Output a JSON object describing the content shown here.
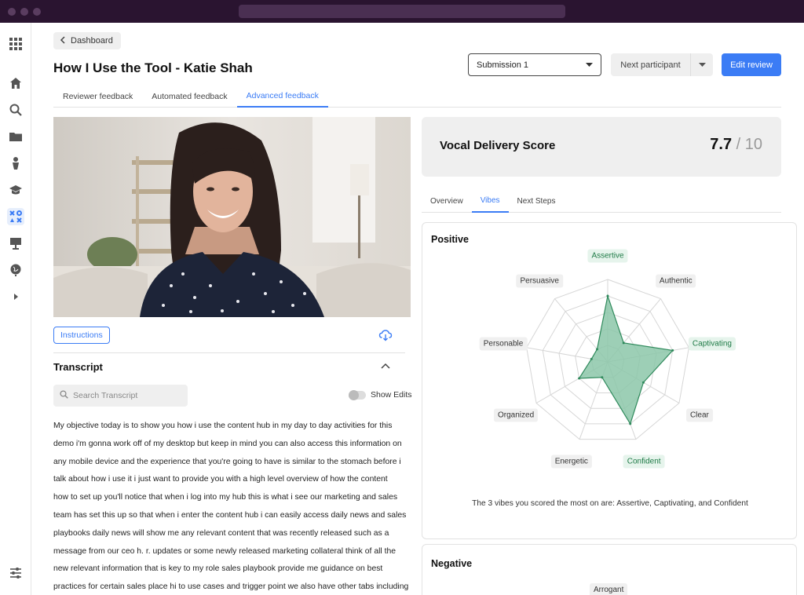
{
  "header": {
    "back_label": "Dashboard",
    "title": "How I Use the Tool - Katie Shah",
    "submission": "Submission 1",
    "next_label": "Next participant",
    "edit_label": "Edit review"
  },
  "tabs": [
    {
      "label": "Reviewer feedback"
    },
    {
      "label": "Automated feedback"
    },
    {
      "label": "Advanced feedback",
      "active": true
    }
  ],
  "video": {
    "instructions_label": "Instructions"
  },
  "transcript": {
    "title": "Transcript",
    "search_placeholder": "Search Transcript",
    "show_edits_label": "Show Edits",
    "lines": [
      "My objective today is to show you how i use the content hub in my day to day activities for this",
      "demo i'm gonna work off of my desktop but keep in mind you can also access this information on",
      "any mobile device and the experience that you're going to have is similar to the stomach before i",
      "talk about how i use it i just want to provide you with a high level overview of how the content",
      "how to set up you'll notice that when i log into my hub this is what i see our marketing and sales",
      "team has set this up so that when i enter the content hub i can easily access daily news and sales",
      "playbooks daily news will show me any relevant content that was recently released such as a",
      "message from our ceo h. r. updates or some newly released marketing collateral think of all the",
      "new relevant information that is key to my role sales playbook provide me guidance on best",
      "practices for certain sales place hi to use cases and trigger point we also have other tabs including"
    ]
  },
  "score": {
    "label": "Vocal Delivery Score",
    "value": "7.7",
    "max": "/ 10"
  },
  "subtabs": [
    {
      "label": "Overview"
    },
    {
      "label": "Vibes",
      "active": true
    },
    {
      "label": "Next Steps"
    }
  ],
  "positive": {
    "title": "Positive",
    "summary": "The 3 vibes you scored the most on are: Assertive, Captivating, and Confident",
    "chart_data": {
      "type": "radar",
      "max": 5,
      "axes": [
        "Assertive",
        "Authentic",
        "Captivating",
        "Clear",
        "Confident",
        "Energetic",
        "Organized",
        "Personable",
        "Persuasive"
      ],
      "values": [
        4,
        1.5,
        4,
        2.5,
        4,
        1,
        2,
        1,
        1
      ],
      "highlighted": [
        "Assertive",
        "Captivating",
        "Confident"
      ]
    }
  },
  "negative": {
    "title": "Negative",
    "first_axis": "Arrogant"
  },
  "colors": {
    "accent": "#3b7cf5",
    "radar_fill": "#8cc7a9",
    "radar_stroke": "#2f8a5c",
    "highlight_text": "#1e7a46",
    "chrome": "#2a1430"
  }
}
